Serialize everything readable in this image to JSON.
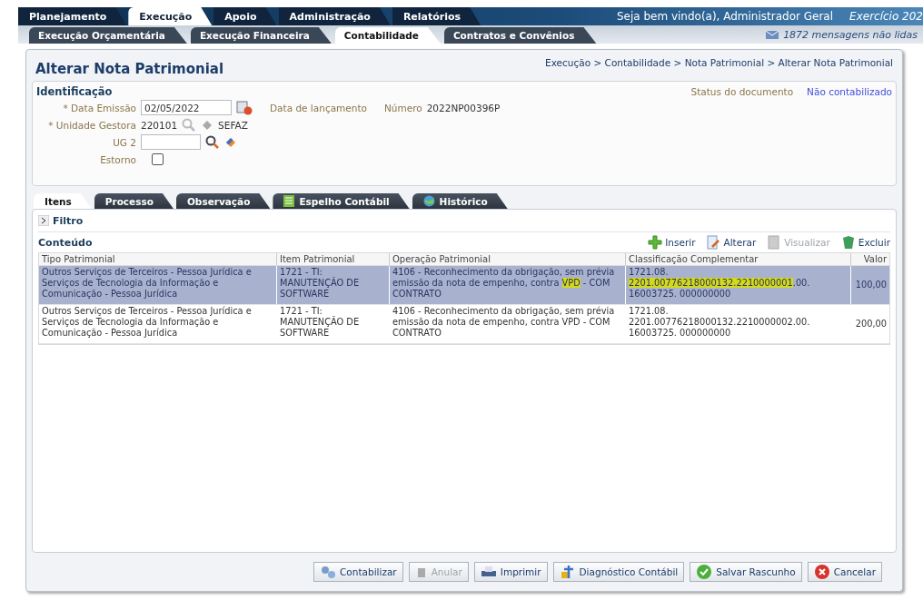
{
  "top_tabs": [
    {
      "label": "Planejamento",
      "selected": false
    },
    {
      "label": "Execução",
      "selected": true
    },
    {
      "label": "Apoio",
      "selected": false
    },
    {
      "label": "Administração",
      "selected": false
    },
    {
      "label": "Relatórios",
      "selected": false
    }
  ],
  "welcome": "Seja bem vindo(a), Administrador Geral",
  "exercise": "Exercício 202",
  "sub_tabs": [
    {
      "label": "Execução Orçamentária",
      "selected": false
    },
    {
      "label": "Execução Financeira",
      "selected": false
    },
    {
      "label": "Contabilidade",
      "selected": true
    },
    {
      "label": "Contratos e Convênios",
      "selected": false
    }
  ],
  "messages": "1872 mensagens não lidas",
  "page_title": "Alterar Nota Patrimonial",
  "breadcrumb": "Execução > Contabilidade > Nota Patrimonial > Alterar Nota Patrimonial",
  "identification": {
    "title": "Identificação",
    "status_label": "Status do documento",
    "status_value": "Não contabilizado",
    "date_label": "* Data Emissão",
    "date_value": "02/05/2022",
    "posting_label": "Data de lançamento",
    "number_label": "Número",
    "number_value": "2022NP00396P",
    "unit_label": "* Unidade Gestora",
    "unit_code": "220101",
    "unit_name": "SEFAZ",
    "ug2_label": "UG 2",
    "reversal_label": "Estorno",
    "reversal_checked": false
  },
  "detail_tabs": [
    {
      "label": "Itens",
      "selected": true
    },
    {
      "label": "Processo",
      "selected": false
    },
    {
      "label": "Observação",
      "selected": false
    },
    {
      "label": "Espelho Contábil",
      "selected": false
    },
    {
      "label": "Histórico",
      "selected": false
    }
  ],
  "filter": "Filtro",
  "content_title": "Conteúdo",
  "actions": [
    {
      "label": "Inserir",
      "disabled": false
    },
    {
      "label": "Alterar",
      "disabled": false
    },
    {
      "label": "Visualizar",
      "disabled": true
    },
    {
      "label": "Excluir",
      "disabled": false
    }
  ],
  "table": {
    "columns": [
      "Tipo Patrimonial",
      "Item Patrimonial",
      "Operação Patrimonial",
      "Classificação Complementar",
      "Valor"
    ],
    "rows": [
      {
        "selected": true,
        "cells": [
          [
            {
              "text": "Outros Serviços de Terceiros - Pessoa Jurídica e Serviços de Tecnologia da Informação e Comunicação - Pessoa Jurídica",
              "highlighted": false
            }
          ],
          [
            {
              "text": "1721 - TI: MANUTENÇÃO DE SOFTWARE",
              "highlighted": false
            }
          ],
          [
            {
              "text": "4106 - Reconhecimento da obrigação, sem prévia emissão da nota de empenho, contra ",
              "highlighted": false
            },
            {
              "text": "VPD",
              "highlighted": true
            },
            {
              "text": " - COM CONTRATO",
              "highlighted": false
            }
          ],
          [
            {
              "text": "1721.08. ",
              "highlighted": false
            },
            {
              "text": "2201.00776218000132.2210000001",
              "highlighted": true
            },
            {
              "text": ".00. 16003725. 000000000",
              "highlighted": false
            }
          ],
          [
            {
              "text": "100,00",
              "highlighted": false
            }
          ]
        ]
      },
      {
        "selected": false,
        "cells": [
          [
            {
              "text": "Outros Serviços de Terceiros - Pessoa Jurídica e Serviços de Tecnologia da Informação e Comunicação - Pessoa Jurídica",
              "highlighted": false
            }
          ],
          [
            {
              "text": "1721 - TI: MANUTENÇÃO DE SOFTWARE",
              "highlighted": false
            }
          ],
          [
            {
              "text": "4106 - Reconhecimento da obrigação, sem prévia emissão da nota de empenho, contra VPD - COM CONTRATO",
              "highlighted": false
            }
          ],
          [
            {
              "text": "1721.08. 2201.00776218000132.2210000002.00. 16003725. 000000000",
              "highlighted": false
            }
          ],
          [
            {
              "text": "200,00",
              "highlighted": false
            }
          ]
        ]
      }
    ]
  },
  "buttons": [
    {
      "label": "Contabilizar",
      "disabled": false
    },
    {
      "label": "Anular",
      "disabled": true
    },
    {
      "label": "Imprimir",
      "disabled": false
    },
    {
      "label": "Diagnóstico Contábil",
      "disabled": false
    },
    {
      "label": "Salvar Rascunho",
      "disabled": false
    },
    {
      "label": "Cancelar",
      "disabled": false
    }
  ]
}
